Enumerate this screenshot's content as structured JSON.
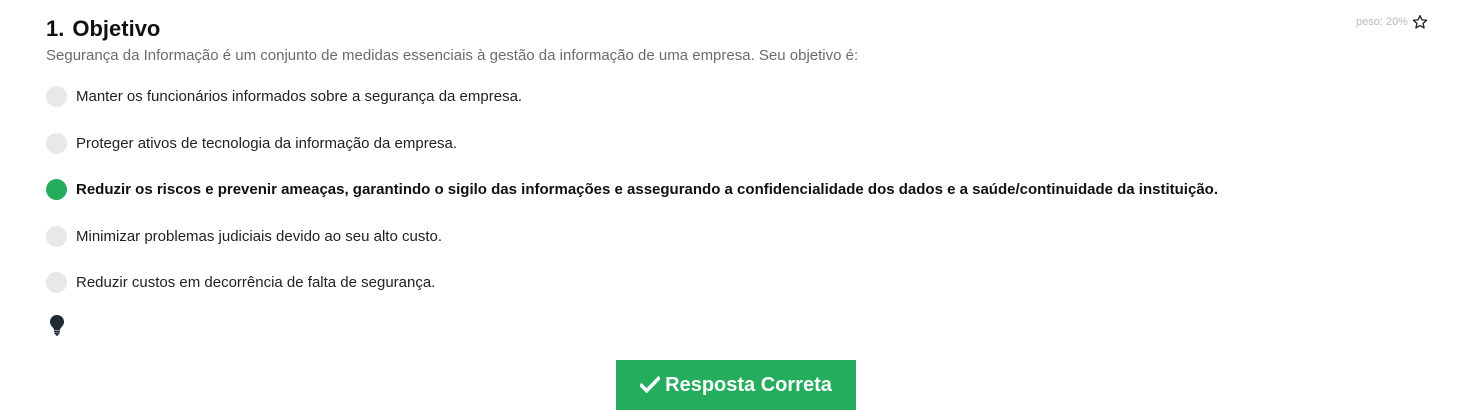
{
  "question": {
    "number": "1.",
    "title": "Objetivo",
    "weight": "peso: 20%",
    "prompt": "Segurança da Informação é um conjunto de medidas essenciais à gestão da informação de uma empresa. Seu objetivo é:"
  },
  "options": [
    {
      "label": "Manter os funcionários informados sobre a segurança da empresa.",
      "selected": false
    },
    {
      "label": "Proteger ativos de tecnologia da informação da empresa.",
      "selected": false
    },
    {
      "label": "Reduzir os riscos e prevenir ameaças, garantindo o sigilo das informações e assegurando a confidencialidade dos dados e a saúde/continuidade da instituição.",
      "selected": true
    },
    {
      "label": "Minimizar problemas judiciais devido ao seu alto custo.",
      "selected": false
    },
    {
      "label": "Reduzir custos em decorrência de falta de segurança.",
      "selected": false
    }
  ],
  "icons": {
    "favorite": "star-outline-icon",
    "hint": "lightbulb-icon",
    "result": "check-icon"
  },
  "result_button": {
    "label": "Resposta Correta"
  },
  "colors": {
    "accent": "#23ad5c",
    "radio_unselected": "#e8e8ea",
    "prompt_text": "#6b6b6b",
    "weight_text": "#b9b9b9"
  }
}
